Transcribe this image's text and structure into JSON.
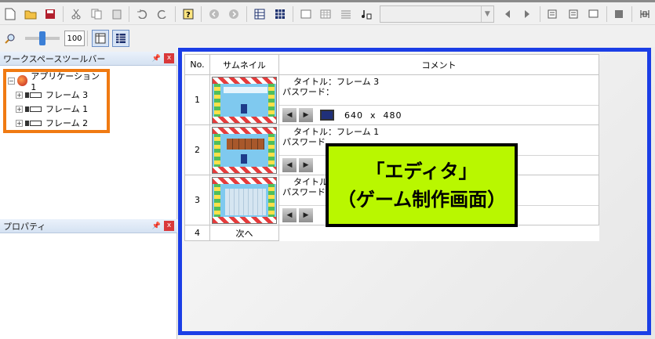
{
  "panes": {
    "workspace_title": "ワークスペースツールバー",
    "properties_title": "プロパティ",
    "pin_icon": "pin-icon",
    "close_label": "x"
  },
  "tree": {
    "root": "アプリケーション 1",
    "frames": [
      "フレーム 3",
      "フレーム 1",
      "フレーム 2"
    ]
  },
  "zoom": {
    "value": "100"
  },
  "table": {
    "headers": {
      "no": "No.",
      "thumb": "サムネイル",
      "comment": "コメント"
    },
    "rows": [
      {
        "no": "1",
        "title_line": "タイトル：フレーム 3",
        "password_line": "パスワード：",
        "width": "640",
        "x": "x",
        "height": "480"
      },
      {
        "no": "2",
        "title_line": "タイトル：フレーム 1",
        "password_line": "パスワード"
      },
      {
        "no": "3",
        "title_line": "タイトル",
        "password_line": "パスワード"
      }
    ],
    "next_no": "4",
    "next_label": "次へ"
  },
  "caption": {
    "line1": "「エディタ」",
    "line2": "（ゲーム制作画面）"
  },
  "colors": {
    "highlight_orange": "#f07a12",
    "highlight_blue": "#1b3ee6",
    "caption_bg": "#b9f700"
  }
}
